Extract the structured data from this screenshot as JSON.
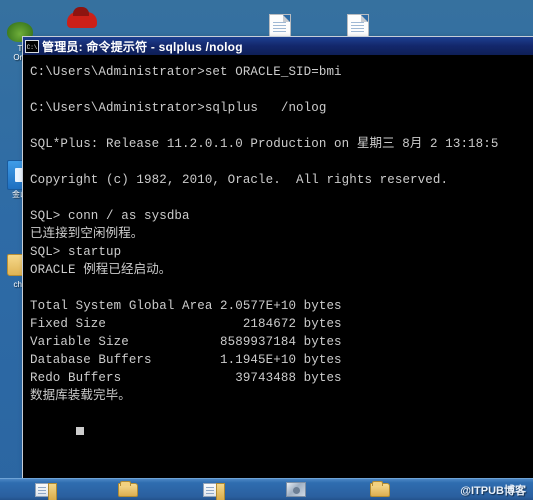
{
  "window": {
    "title": "管理员: 命令提示符 - sqlplus   /nolog",
    "icon_label": "C:\\"
  },
  "console": {
    "lines": [
      "C:\\Users\\Administrator>set ORACLE_SID=bmi",
      "",
      "C:\\Users\\Administrator>sqlplus   /nolog",
      "",
      "SQL*Plus: Release 11.2.0.1.0 Production on 星期三 8月 2 13:18:5",
      "",
      "Copyright (c) 1982, 2010, Oracle.  All rights reserved.",
      "",
      "SQL> conn / as sysdba",
      "已连接到空闲例程。",
      "SQL> startup",
      "ORACLE 例程已经启动。",
      "",
      "Total System Global Area 2.0577E+10 bytes",
      "Fixed Size                  2184672 bytes",
      "Variable Size            8589937184 bytes",
      "Database Buffers         1.1945E+10 bytes",
      "Redo Buffers               39743488 bytes",
      "数据库装载完毕。"
    ]
  },
  "desktop": {
    "icons": [
      {
        "label": "T\nOre",
        "glyph": "frog-icon"
      },
      {
        "label": "金山",
        "glyph": "blue-app-icon"
      },
      {
        "label": "che",
        "glyph": "folder-icon"
      },
      {
        "label": "",
        "glyph": "car-icon"
      },
      {
        "label": "",
        "glyph": "document-icon"
      },
      {
        "label": "",
        "glyph": "document-icon"
      }
    ]
  },
  "taskbar": {
    "items": [
      {
        "name": "taskbar-document-1",
        "glyph": "document-icon"
      },
      {
        "name": "taskbar-folder-1",
        "glyph": "folder-icon"
      },
      {
        "name": "taskbar-document-2",
        "glyph": "document-icon"
      },
      {
        "name": "taskbar-disc",
        "glyph": "disc-icon"
      },
      {
        "name": "taskbar-folder-2",
        "glyph": "folder-icon"
      }
    ],
    "watermark": "@ITPUB博客"
  },
  "colors": {
    "desktop_blue": "#2e6ba6",
    "titlebar_blue": "#13276b",
    "console_bg": "#000000",
    "console_fg": "#cccccc",
    "taskbar_blue": "#2f6db0"
  }
}
